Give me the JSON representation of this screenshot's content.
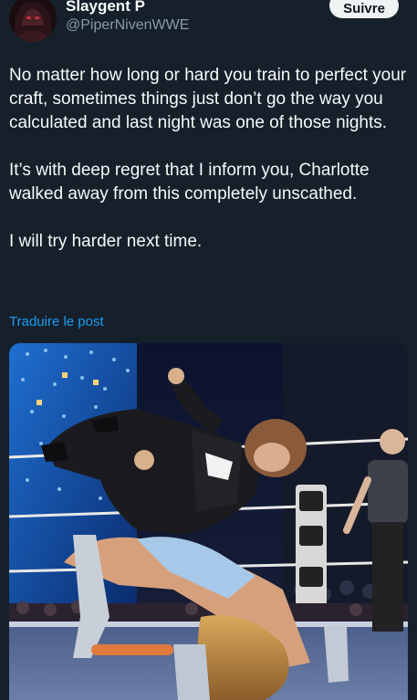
{
  "author": {
    "display_name": "Slaygent P",
    "handle": "@PiperNivenWWE"
  },
  "actions": {
    "follow_label": "Suivre"
  },
  "tweet": {
    "paragraphs": [
      "No matter how long or hard you train to perfect your craft, sometimes things just don’t go the way you calculated and last night was one of those nights.",
      "It’s with deep regret that I inform you, Charlotte walked away from this completely unscathed.",
      "I will try harder next time."
    ],
    "translate_label": "Traduire le post"
  },
  "colors": {
    "background": "#15202b",
    "text_primary": "#f7f9f9",
    "text_secondary": "#8b98a5",
    "link": "#1d9bf0",
    "button_bg": "#eff3f4"
  },
  "icons": {
    "avatar": "profile-avatar"
  }
}
